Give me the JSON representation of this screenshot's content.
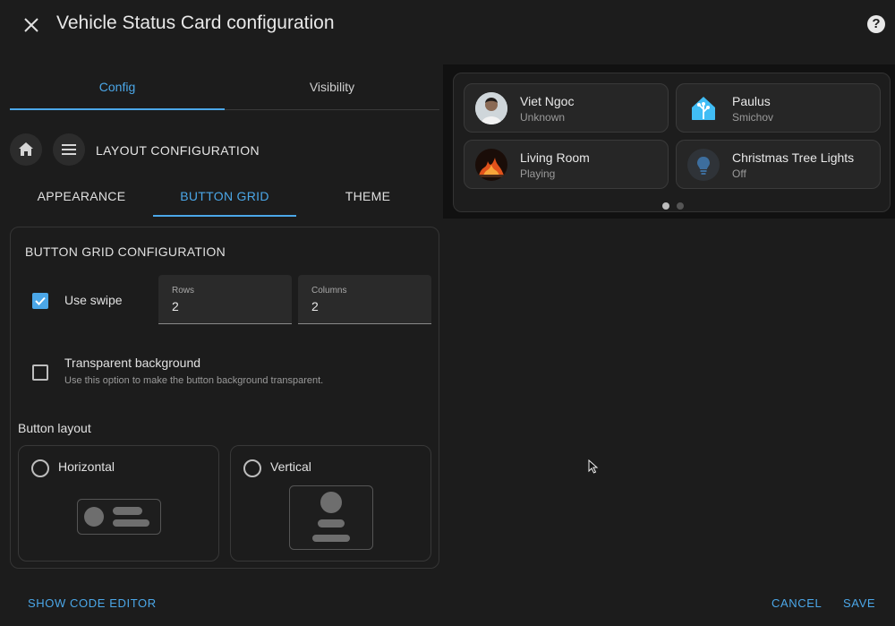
{
  "dialog": {
    "title": "Vehicle Status Card configuration",
    "close_icon": "close-icon",
    "help_icon": "help-icon",
    "help_glyph": "?"
  },
  "top_tabs": [
    {
      "label": "Config",
      "active": true
    },
    {
      "label": "Visibility",
      "active": false
    }
  ],
  "layout_header": {
    "home_icon": "home-icon",
    "menu_icon": "menu-icon",
    "title": "LAYOUT CONFIGURATION"
  },
  "sub_tabs": [
    {
      "label": "APPEARANCE",
      "active": false
    },
    {
      "label": "BUTTON GRID",
      "active": true
    },
    {
      "label": "THEME",
      "active": false
    }
  ],
  "button_grid": {
    "title": "BUTTON GRID CONFIGURATION",
    "use_swipe": {
      "label": "Use swipe",
      "checked": true
    },
    "rows": {
      "label": "Rows",
      "value": "2"
    },
    "columns": {
      "label": "Columns",
      "value": "2"
    },
    "transparent_background": {
      "label": "Transparent background",
      "helper": "Use this option to make the button background transparent.",
      "checked": false
    },
    "button_layout": {
      "label": "Button layout",
      "options": [
        {
          "label": "Horizontal",
          "selected": false
        },
        {
          "label": "Vertical",
          "selected": false
        }
      ]
    }
  },
  "preview": {
    "entities": [
      {
        "name": "Viet Ngoc",
        "state": "Unknown",
        "icon": "person-avatar"
      },
      {
        "name": "Paulus",
        "state": "Smichov",
        "icon": "home-assistant-logo-icon"
      },
      {
        "name": "Living Room",
        "state": "Playing",
        "icon": "fireplace-thumbnail"
      },
      {
        "name": "Christmas Tree Lights",
        "state": "Off",
        "icon": "lightbulb-icon"
      }
    ],
    "page_dots": 2,
    "active_dot": 0
  },
  "footer": {
    "show_code_editor": "SHOW CODE EDITOR",
    "cancel": "CANCEL",
    "save": "SAVE"
  },
  "colors": {
    "accent": "#4ba7e8",
    "background": "#1c1c1c",
    "preview_background": "#111111"
  }
}
